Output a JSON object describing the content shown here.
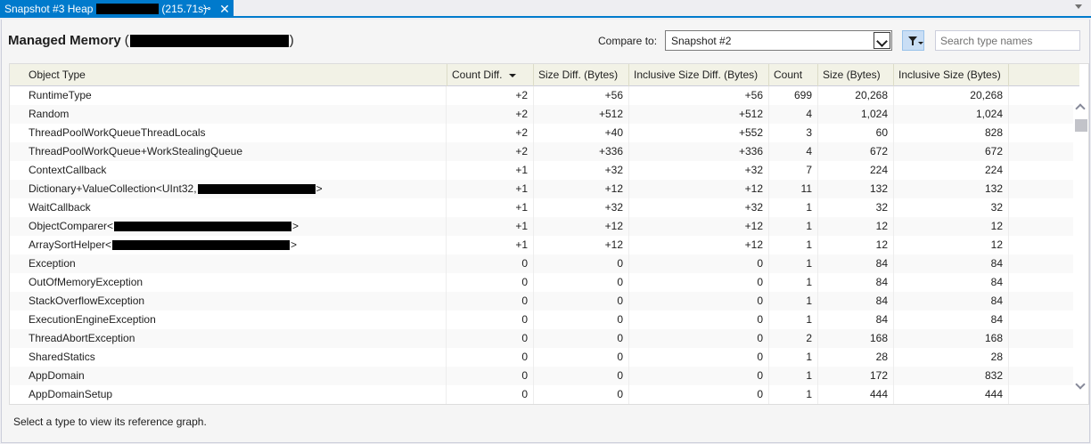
{
  "tab": {
    "title_prefix": "Snapshot #3 Heap",
    "title_suffix": "(215.71s)",
    "pin_glyph": "⊸",
    "close_glyph": "✕"
  },
  "header": {
    "title": "Managed Memory",
    "open_paren": "(",
    "close_paren": ")"
  },
  "compare": {
    "label": "Compare to:",
    "selected": "Snapshot #2"
  },
  "search": {
    "placeholder": "Search type names",
    "value": ""
  },
  "grid": {
    "sorted_column": "Count Diff.",
    "columns": [
      "Object Type",
      "Count Diff.",
      "Size Diff. (Bytes)",
      "Inclusive Size Diff. (Bytes)",
      "Count",
      "Size (Bytes)",
      "Inclusive Size (Bytes)"
    ],
    "rows": [
      {
        "name": "RuntimeType",
        "count_diff": "+2",
        "size_diff": "+56",
        "incl_size_diff": "+56",
        "count": "699",
        "size": "20,268",
        "incl_size": "20,268"
      },
      {
        "name": "Random",
        "count_diff": "+2",
        "size_diff": "+512",
        "incl_size_diff": "+512",
        "count": "4",
        "size": "1,024",
        "incl_size": "1,024"
      },
      {
        "name": "ThreadPoolWorkQueueThreadLocals",
        "count_diff": "+2",
        "size_diff": "+40",
        "incl_size_diff": "+552",
        "count": "3",
        "size": "60",
        "incl_size": "828"
      },
      {
        "name": "ThreadPoolWorkQueue+WorkStealingQueue",
        "count_diff": "+2",
        "size_diff": "+336",
        "incl_size_diff": "+336",
        "count": "4",
        "size": "672",
        "incl_size": "672"
      },
      {
        "name": "ContextCallback",
        "count_diff": "+1",
        "size_diff": "+32",
        "incl_size_diff": "+32",
        "count": "7",
        "size": "224",
        "incl_size": "224"
      },
      {
        "name": "Dictionary+ValueCollection<UInt32,",
        "name_end": ">",
        "redacted": true,
        "count_diff": "+1",
        "size_diff": "+12",
        "incl_size_diff": "+12",
        "count": "11",
        "size": "132",
        "incl_size": "132"
      },
      {
        "name": "WaitCallback",
        "count_diff": "+1",
        "size_diff": "+32",
        "incl_size_diff": "+32",
        "count": "1",
        "size": "32",
        "incl_size": "32"
      },
      {
        "name": "ObjectComparer<",
        "name_end": ">",
        "redacted": true,
        "count_diff": "+1",
        "size_diff": "+12",
        "incl_size_diff": "+12",
        "count": "1",
        "size": "12",
        "incl_size": "12"
      },
      {
        "name": "ArraySortHelper<",
        "name_end": ">",
        "redacted": true,
        "count_diff": "+1",
        "size_diff": "+12",
        "incl_size_diff": "+12",
        "count": "1",
        "size": "12",
        "incl_size": "12"
      },
      {
        "name": "Exception",
        "count_diff": "0",
        "size_diff": "0",
        "incl_size_diff": "0",
        "count": "1",
        "size": "84",
        "incl_size": "84"
      },
      {
        "name": "OutOfMemoryException",
        "count_diff": "0",
        "size_diff": "0",
        "incl_size_diff": "0",
        "count": "1",
        "size": "84",
        "incl_size": "84"
      },
      {
        "name": "StackOverflowException",
        "count_diff": "0",
        "size_diff": "0",
        "incl_size_diff": "0",
        "count": "1",
        "size": "84",
        "incl_size": "84"
      },
      {
        "name": "ExecutionEngineException",
        "count_diff": "0",
        "size_diff": "0",
        "incl_size_diff": "0",
        "count": "1",
        "size": "84",
        "incl_size": "84"
      },
      {
        "name": "ThreadAbortException",
        "count_diff": "0",
        "size_diff": "0",
        "incl_size_diff": "0",
        "count": "2",
        "size": "168",
        "incl_size": "168"
      },
      {
        "name": "SharedStatics",
        "count_diff": "0",
        "size_diff": "0",
        "incl_size_diff": "0",
        "count": "1",
        "size": "28",
        "incl_size": "28"
      },
      {
        "name": "AppDomain",
        "count_diff": "0",
        "size_diff": "0",
        "incl_size_diff": "0",
        "count": "1",
        "size": "172",
        "incl_size": "832"
      },
      {
        "name": "AppDomainSetup",
        "count_diff": "0",
        "size_diff": "0",
        "incl_size_diff": "0",
        "count": "1",
        "size": "444",
        "incl_size": "444"
      }
    ]
  },
  "status": {
    "text": "Select a type to view its reference graph."
  },
  "colors": {
    "accent": "#007ACC",
    "header_bg": "#F2F2E6",
    "panel_bg": "#F5F5F5"
  },
  "icons": {
    "pin": "pin-icon",
    "close": "close-icon",
    "filter": "filter-icon",
    "dropdown": "chevron-down-icon"
  }
}
